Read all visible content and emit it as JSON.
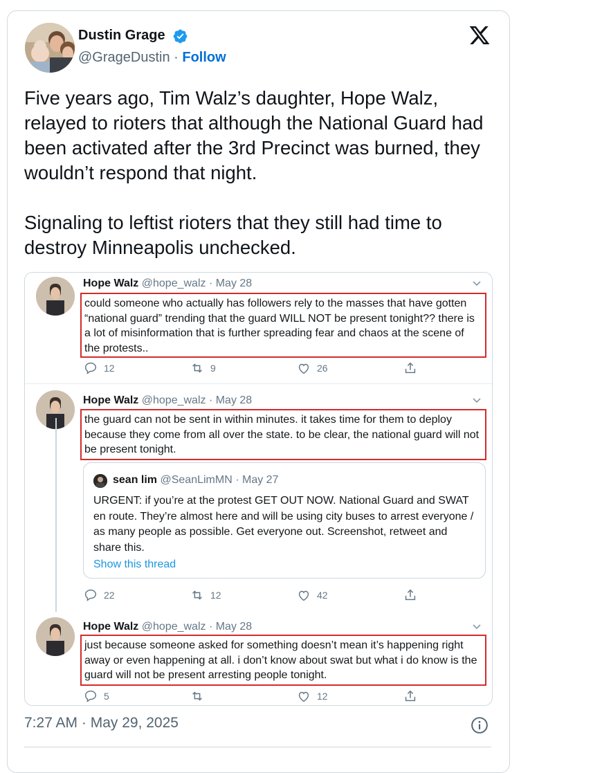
{
  "author": {
    "name": "Dustin Grage",
    "handle": "@GrageDustin",
    "separator": " · ",
    "follow_label": "Follow",
    "verified_color": "#1d9bf0"
  },
  "tweet": {
    "paragraphs": [
      "Five years ago, Tim Walz’s daughter, Hope Walz, relayed to rioters that although the National Guard had been activated after the 3rd Precinct was burned, they wouldn’t respond that night.",
      "Signaling to leftist rioters that they still had time to destroy Minneapolis unchecked."
    ],
    "timestamp": "7:27 AM · May 29, 2025"
  },
  "embedded_thread": [
    {
      "name": "Hope Walz",
      "handle": "@hope_walz",
      "date": "· May 28",
      "text": "could someone who actually has followers rely to the masses that have gotten “national guard” trending that the guard WILL NOT be present tonight?? there is a lot of misinformation that is further spreading fear and chaos at the scene of the protests..",
      "replies": "12",
      "retweets": "9",
      "likes": "26"
    },
    {
      "name": "Hope Walz",
      "handle": "@hope_walz",
      "date": "· May 28",
      "text": "the guard can not be sent in within minutes. it takes time for them to deploy because they come from all over the state. to be clear, the national guard will not be present tonight.",
      "replies": "22",
      "retweets": "12",
      "likes": "42",
      "quoted": {
        "name": "sean lim",
        "handle": "@SeanLimMN",
        "date": "· May 27",
        "text": "URGENT: if you’re at the protest GET OUT NOW. National Guard and SWAT en route. They’re almost here and will be using city buses to arrest everyone / as many people as possible. Get everyone out. Screenshot, retweet and share this.",
        "link": "Show this thread"
      }
    },
    {
      "name": "Hope Walz",
      "handle": "@hope_walz",
      "date": "· May 28",
      "text": "just because someone asked for something doesn’t mean it’s happening right away or even happening at all. i don’t know about swat but what i do know is the guard will not be present arresting people tonight.",
      "replies": "5",
      "retweets": "",
      "likes": "12"
    }
  ],
  "colors": {
    "highlight_border": "#d42b2b",
    "link": "#006fd6"
  },
  "icons": {
    "brand": "x-logo-icon",
    "info": "info-icon",
    "reply": "reply-icon",
    "retweet": "retweet-icon",
    "like": "heart-icon",
    "share": "share-icon",
    "menu": "chevron-down-icon"
  }
}
